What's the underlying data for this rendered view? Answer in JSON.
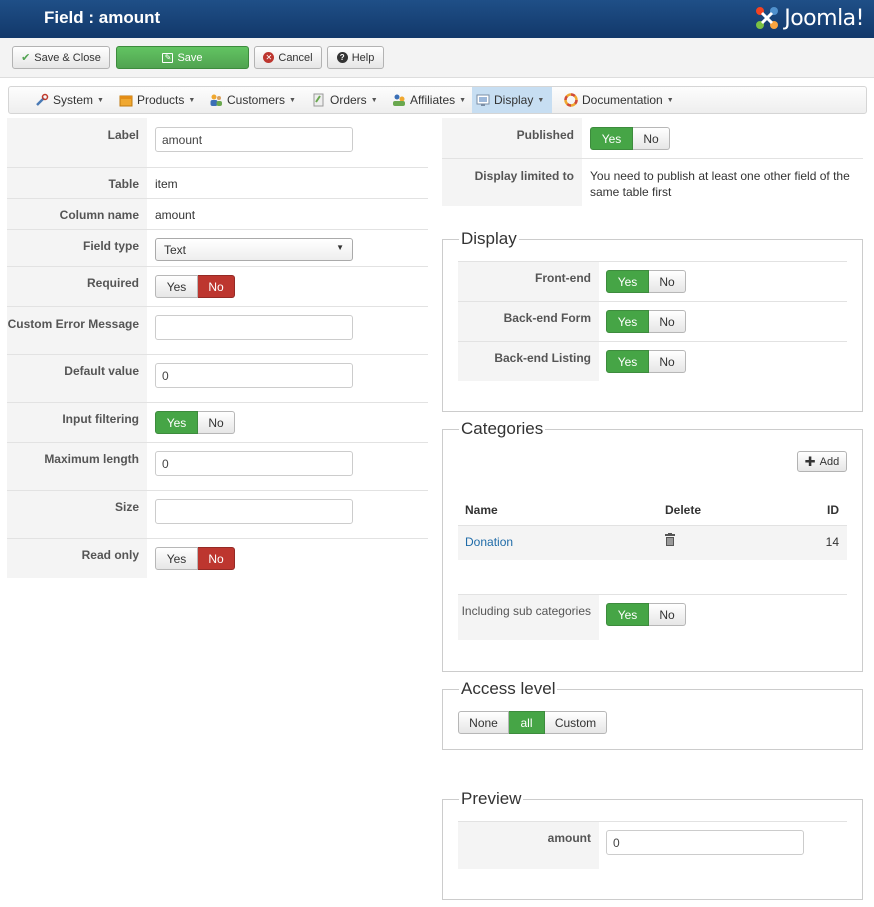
{
  "header": {
    "title": "Field : amount",
    "logo_text": "Joomla!"
  },
  "toolbar": {
    "save_close": "Save & Close",
    "save": "Save",
    "cancel": "Cancel",
    "help": "Help"
  },
  "menu": {
    "items": [
      {
        "label": "System",
        "icon": "wrench-icon"
      },
      {
        "label": "Products",
        "icon": "box-icon"
      },
      {
        "label": "Customers",
        "icon": "users-icon"
      },
      {
        "label": "Orders",
        "icon": "orders-icon"
      },
      {
        "label": "Affiliates",
        "icon": "affiliates-icon"
      },
      {
        "label": "Display",
        "icon": "display-icon",
        "active": true
      },
      {
        "label": "Documentation",
        "icon": "lifebuoy-icon"
      }
    ]
  },
  "form": {
    "label": {
      "label": "Label",
      "value": "amount"
    },
    "table": {
      "label": "Table",
      "value": "item"
    },
    "column": {
      "label": "Column name",
      "value": "amount"
    },
    "field_type": {
      "label": "Field type",
      "value": "Text"
    },
    "required": {
      "label": "Required",
      "yes": "Yes",
      "no": "No"
    },
    "custom_error": {
      "label": "Custom Error Message",
      "value": ""
    },
    "default_value": {
      "label": "Default value",
      "value": "0"
    },
    "input_filtering": {
      "label": "Input filtering",
      "yes": "Yes",
      "no": "No"
    },
    "max_length": {
      "label": "Maximum length",
      "value": "0"
    },
    "size": {
      "label": "Size",
      "value": ""
    },
    "read_only": {
      "label": "Read only",
      "yes": "Yes",
      "no": "No"
    }
  },
  "right": {
    "published": {
      "label": "Published",
      "yes": "Yes",
      "no": "No"
    },
    "display_limited": {
      "label": "Display limited to",
      "text": "You need to publish at least one other field of the same table first"
    },
    "display": {
      "legend": "Display",
      "frontend": {
        "label": "Front-end",
        "yes": "Yes",
        "no": "No"
      },
      "backend_form": {
        "label": "Back-end Form",
        "yes": "Yes",
        "no": "No"
      },
      "backend_listing": {
        "label": "Back-end Listing",
        "yes": "Yes",
        "no": "No"
      }
    },
    "categories": {
      "legend": "Categories",
      "add": "Add",
      "columns": {
        "name": "Name",
        "delete": "Delete",
        "id": "ID"
      },
      "rows": [
        {
          "name": "Donation",
          "id": "14"
        }
      ],
      "including_sub": {
        "label": "Including sub categories",
        "yes": "Yes",
        "no": "No"
      }
    },
    "access": {
      "legend": "Access level",
      "none": "None",
      "all": "all",
      "custom": "Custom"
    },
    "preview": {
      "legend": "Preview",
      "label": "amount",
      "value": "0"
    }
  }
}
